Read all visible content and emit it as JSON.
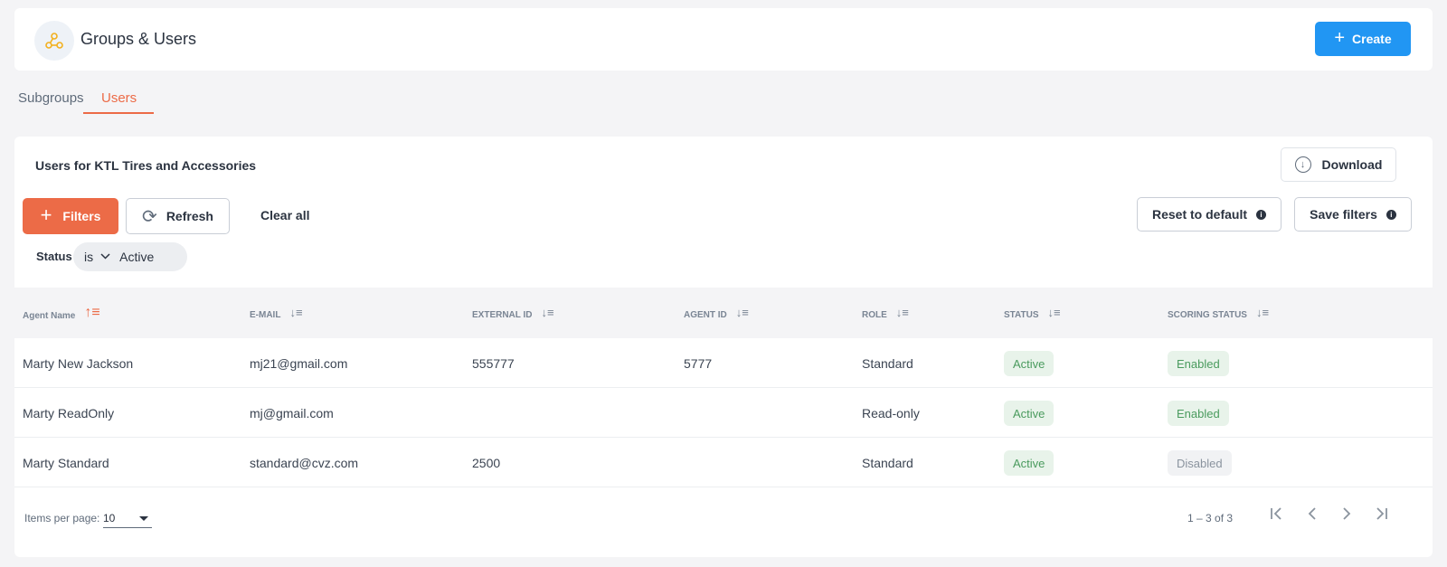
{
  "header": {
    "title": "Groups & Users",
    "icon": "network-groups-icon",
    "create_label": "Create"
  },
  "tabs": [
    {
      "label": "Subgroups",
      "active": false
    },
    {
      "label": "Users",
      "active": true
    }
  ],
  "main": {
    "section_title": "Users for KTL Tires and Accessories",
    "download_label": "Download",
    "filters_label": "Filters",
    "refresh_label": "Refresh",
    "clear_all_label": "Clear all",
    "reset_label": "Reset to default",
    "save_filters_label": "Save filters"
  },
  "filter_chip": {
    "field": "Status",
    "operator": "is",
    "value": "Active"
  },
  "table": {
    "columns": [
      "Agent Name",
      "E-MAIL",
      "EXTERNAL ID",
      "AGENT ID",
      "ROLE",
      "STATUS",
      "SCORING STATUS"
    ],
    "rows": [
      {
        "name": "Marty New Jackson",
        "email": "mj21@gmail.com",
        "external_id": "555777",
        "agent_id": "5777",
        "role": "Standard",
        "status": "Active",
        "scoring": "Enabled"
      },
      {
        "name": "Marty ReadOnly",
        "email": "mj@gmail.com",
        "external_id": "",
        "agent_id": "",
        "role": "Read-only",
        "status": "Active",
        "scoring": "Enabled"
      },
      {
        "name": "Marty Standard",
        "email": "standard@cvz.com",
        "external_id": "2500",
        "agent_id": "",
        "role": "Standard",
        "status": "Active",
        "scoring": "Disabled"
      }
    ]
  },
  "pagination": {
    "items_per_page_label": "Items per page:",
    "items_per_page": "10",
    "range": "1 – 3 of 3"
  },
  "colors": {
    "primary_blue": "#2196f3",
    "accent_orange": "#ec6b47",
    "success_green": "#4a9b5e"
  }
}
